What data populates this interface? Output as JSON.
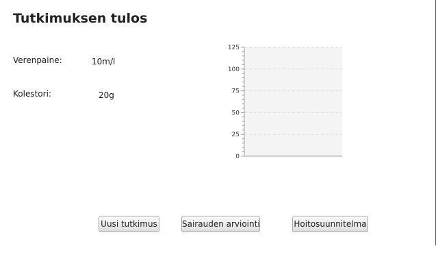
{
  "page": {
    "title": "Tutkimuksen tulos"
  },
  "results": {
    "blood_pressure_label": "Verenpaine:",
    "blood_pressure_value": "10m/l",
    "cholesterol_label": "Kolestori:",
    "cholesterol_value": "20g"
  },
  "chart_data": {
    "type": "bar",
    "categories": [],
    "series": [],
    "title": "",
    "xlabel": "",
    "ylabel": "",
    "ylim": [
      0,
      125
    ],
    "yticks": [
      0,
      25,
      50,
      75,
      100,
      125
    ],
    "grid": true
  },
  "buttons": {
    "new_study": "Uusi tutkimus",
    "disease_evaluation": "Sairauden arviointi",
    "care_plan": "Hoitosuunnitelma"
  },
  "colors": {
    "plot_background": "#f4f4f4",
    "grid_line": "#dcdcdc",
    "axis_line": "#a0a0a0"
  }
}
